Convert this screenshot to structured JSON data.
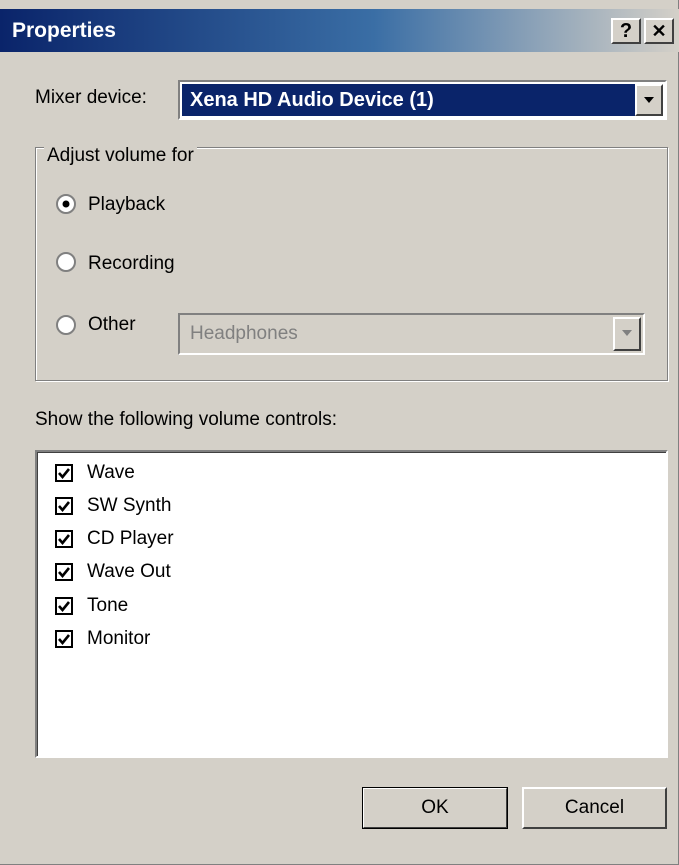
{
  "window": {
    "title": "Properties",
    "help_label": "?",
    "close_label": "✕"
  },
  "mixer": {
    "label": "Mixer device:",
    "selected": "Xena HD Audio Device (1)"
  },
  "adjust": {
    "legend": "Adjust volume for",
    "options": [
      {
        "label": "Playback",
        "selected": true
      },
      {
        "label": "Recording",
        "selected": false
      },
      {
        "label": "Other",
        "selected": false
      }
    ],
    "other_device": "Headphones"
  },
  "controls": {
    "label": "Show the following volume controls:",
    "items": [
      {
        "label": "Wave",
        "checked": true
      },
      {
        "label": "SW Synth",
        "checked": true
      },
      {
        "label": "CD Player",
        "checked": true
      },
      {
        "label": "Wave Out",
        "checked": true
      },
      {
        "label": "Tone",
        "checked": true
      },
      {
        "label": "Monitor",
        "checked": true
      }
    ]
  },
  "buttons": {
    "ok": "OK",
    "cancel": "Cancel"
  },
  "colors": {
    "titlebar_start": "#0a246a",
    "selection": "#0a246a",
    "face": "#d4d0c8"
  }
}
